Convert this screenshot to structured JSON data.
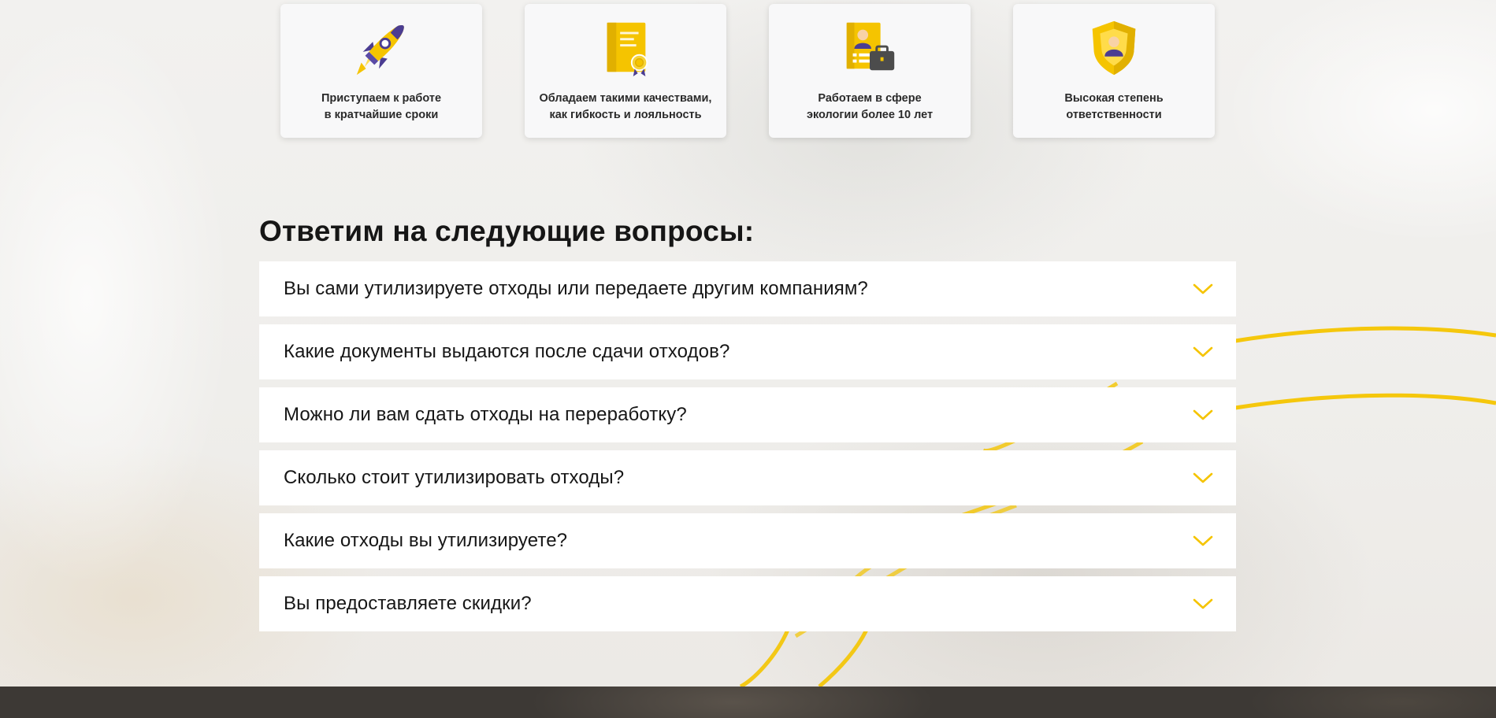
{
  "colors": {
    "accent": "#f5c400",
    "icon_purple": "#4b3d92",
    "card_bg": "#f8f8f9",
    "text_dark": "#161616",
    "footer_bg": "#3d3935"
  },
  "benefits": [
    {
      "icon": "rocket-icon",
      "line1": "Приступаем к работе",
      "line2": "в кратчайшие сроки"
    },
    {
      "icon": "certificate-icon",
      "line1": "Обладаем такими качествами,",
      "line2": "как гибкость и лояльность"
    },
    {
      "icon": "resume-briefcase-icon",
      "line1": "Работаем в сфере",
      "line2": "экологии более 10 лет"
    },
    {
      "icon": "shield-user-icon",
      "line1": "Высокая степень",
      "line2": "ответственности"
    }
  ],
  "faq": {
    "title": "Ответим на следующие вопросы:",
    "items": [
      {
        "question": "Вы сами утилизируете отходы или передаете другим компаниям?",
        "icon": "chevron-down-icon"
      },
      {
        "question": "Какие документы выдаются после сдачи отходов?",
        "icon": "chevron-down-icon"
      },
      {
        "question": "Можно ли вам сдать отходы на переработку?",
        "icon": "chevron-down-icon"
      },
      {
        "question": "Сколько стоит утилизировать отходы?",
        "icon": "chevron-down-icon"
      },
      {
        "question": "Какие отходы вы утилизируете?",
        "icon": "chevron-down-icon"
      },
      {
        "question": "Вы предоставляете скидки?",
        "icon": "chevron-down-icon"
      }
    ]
  }
}
